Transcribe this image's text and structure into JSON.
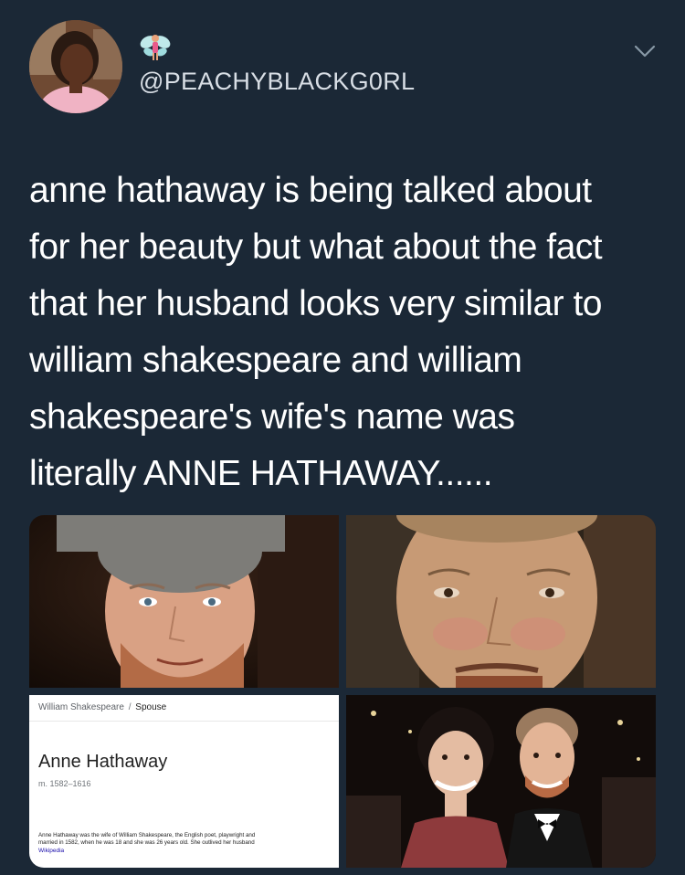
{
  "tweet": {
    "handle": "@PEACHYBLACKG0RL",
    "name_emoji_icon": "fairy-emoji-icon",
    "menu_icon": "chevron-down-icon",
    "text_lines": [
      "anne hathaway is being talked about",
      "for her beauty but what about the fact",
      "that her husband looks very similar to",
      "william shakespeare and william",
      "shakespeare's wife's name was",
      "literally ANNE HATHAWAY......"
    ]
  },
  "media": {
    "photos": [
      "photo-man-red-beard",
      "portrait-william-shakespeare",
      "search-card-screenshot",
      "photo-couple-tuxedo"
    ],
    "search_card": {
      "breadcrumb_parent": "William Shakespeare",
      "breadcrumb_separator": "/",
      "breadcrumb_current": "Spouse",
      "name": "Anne Hathaway",
      "dates": "m. 1582–1616",
      "description_line_1": "Anne Hathaway was the wife of William Shakespeare, the English poet, playwright and",
      "description_line_2": "married in 1582, when he was 18 and she was 26 years old. She outlived her husband",
      "source": "Wikipedia"
    }
  },
  "colors": {
    "background": "#1b2836",
    "text": "#ffffff",
    "handle": "#d8dee5"
  }
}
